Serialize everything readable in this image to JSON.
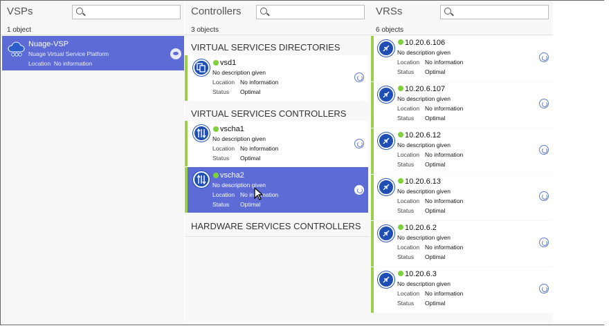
{
  "vsps": {
    "title": "VSPs",
    "count": "1 object",
    "item": {
      "name": "Nuage-VSP",
      "description": "Nuage Virtual Service Platform",
      "location_label": "Location",
      "location_value": "No information"
    }
  },
  "controllers": {
    "title": "Controllers",
    "count": "3 objects",
    "sections": {
      "vsd": "VIRTUAL SERVICES DIRECTORIES",
      "vsc": "VIRTUAL SERVICES CONTROLLERS",
      "hsc": "HARDWARE SERVICES CONTROLLERS"
    },
    "items": [
      {
        "name": "vsd1",
        "description": "No description given",
        "location_label": "Location",
        "location_value": "No information",
        "status_label": "Status",
        "status_value": "Optimal"
      },
      {
        "name": "vscha1",
        "description": "No description given",
        "location_label": "Location",
        "location_value": "No information",
        "status_label": "Status",
        "status_value": "Optimal"
      },
      {
        "name": "vscha2",
        "description": "No description given",
        "location_label": "Location",
        "location_value": "No information",
        "status_label": "Status",
        "status_value": "Optimal"
      }
    ]
  },
  "vrss": {
    "title": "VRSs",
    "count": "6 objects",
    "items": [
      {
        "name": "10.20.6.106",
        "description": "No description given",
        "location_label": "Location",
        "location_value": "No information",
        "status_label": "Status",
        "status_value": "Optimal"
      },
      {
        "name": "10.20.6.107",
        "description": "No description given",
        "location_label": "Location",
        "location_value": "No information",
        "status_label": "Status",
        "status_value": "Optimal"
      },
      {
        "name": "10.20.6.12",
        "description": "No description given",
        "location_label": "Location",
        "location_value": "No information",
        "status_label": "Status",
        "status_value": "Optimal"
      },
      {
        "name": "10.20.6.13",
        "description": "No description given",
        "location_label": "Location",
        "location_value": "No information",
        "status_label": "Status",
        "status_value": "Optimal"
      },
      {
        "name": "10.20.6.2",
        "description": "No description given",
        "location_label": "Location",
        "location_value": "No information",
        "status_label": "Status",
        "status_value": "Optimal"
      },
      {
        "name": "10.20.6.3",
        "description": "No description given",
        "location_label": "Location",
        "location_value": "No information",
        "status_label": "Status",
        "status_value": "Optimal"
      }
    ]
  },
  "colors": {
    "selection": "#5c6bd6",
    "status_ok": "#7fd13b",
    "accent_bar": "#9ad04a",
    "icon_blue": "#1f4fb5"
  },
  "icons": {
    "search": "search-icon",
    "vsp": "cloud-network-icon",
    "vsd": "directory-icon",
    "vsc": "controller-icon",
    "vrs": "switch-icon",
    "action": "refresh-icon",
    "view": "eye-icon"
  }
}
